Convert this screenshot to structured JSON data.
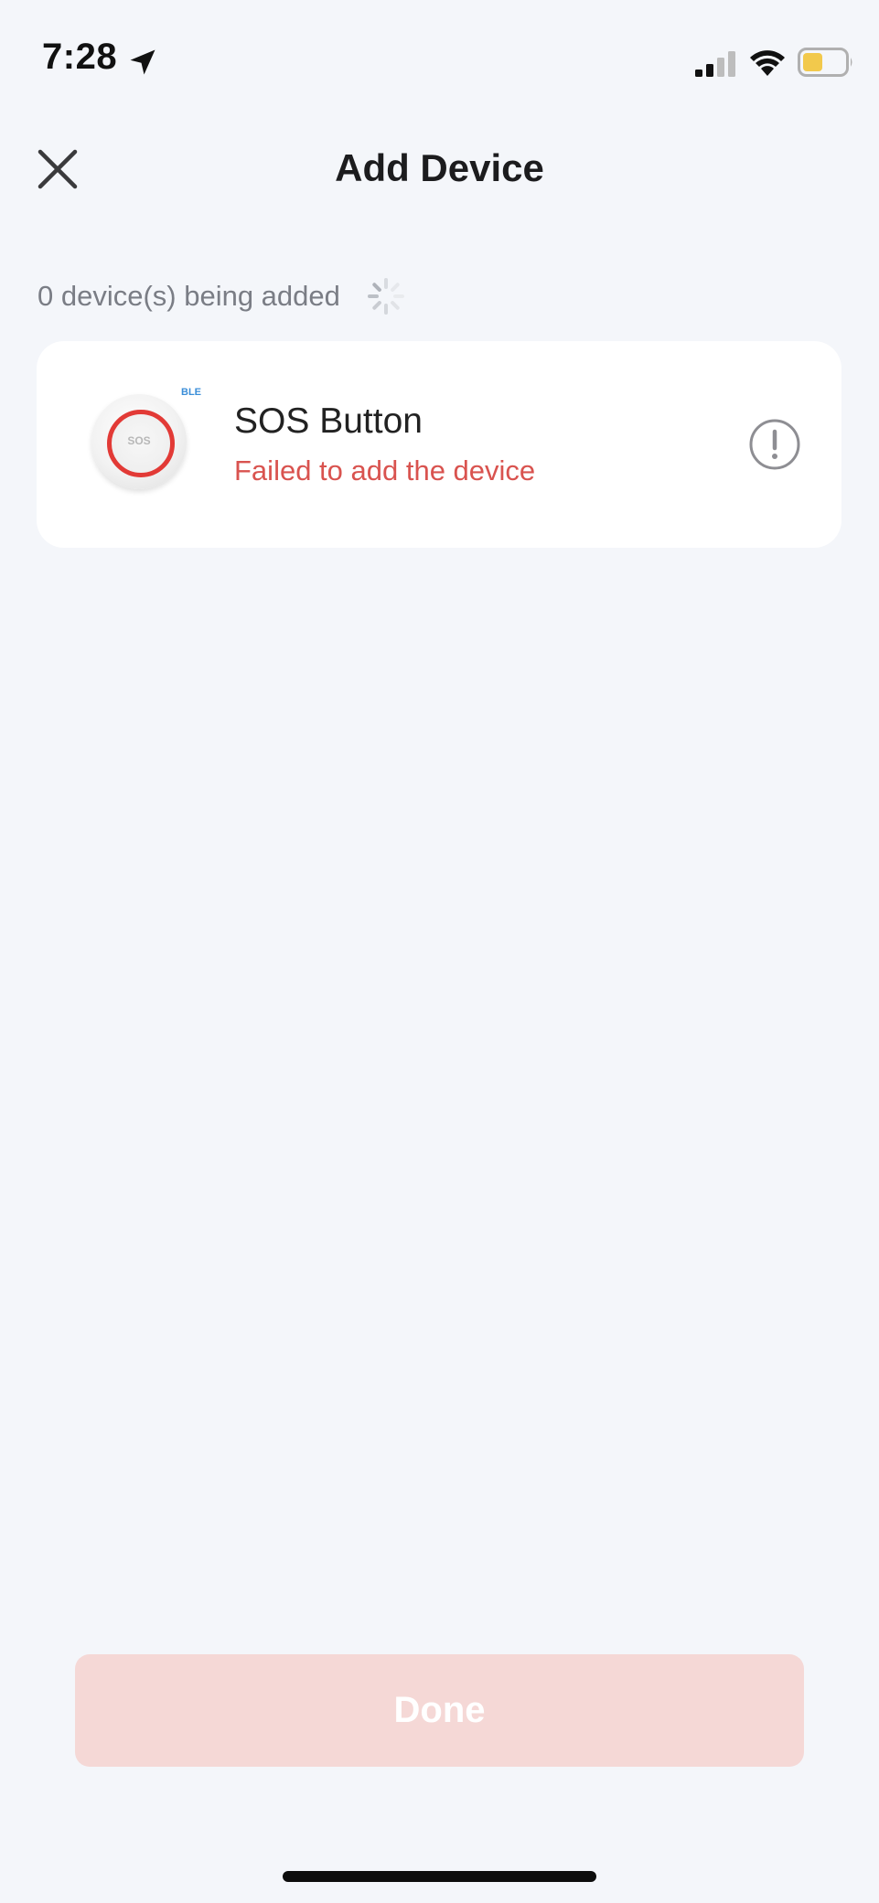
{
  "status_bar": {
    "time": "7:28",
    "icons": [
      "location-arrow-icon",
      "cellular-signal-icon",
      "wifi-icon",
      "battery-icon"
    ],
    "battery_color": "#f2c94c"
  },
  "header": {
    "title": "Add Device",
    "close_icon": "close-icon"
  },
  "progress": {
    "text": "0 device(s) being added",
    "spinner_icon": "spinner-icon"
  },
  "devices": [
    {
      "name": "SOS Button",
      "badge": "BLE",
      "image_label": "SOS",
      "status": "Failed to add the device",
      "status_color": "#d9534f",
      "action_icon": "warning-icon"
    }
  ],
  "footer": {
    "done_label": "Done",
    "done_color": "#f5d8d6"
  }
}
